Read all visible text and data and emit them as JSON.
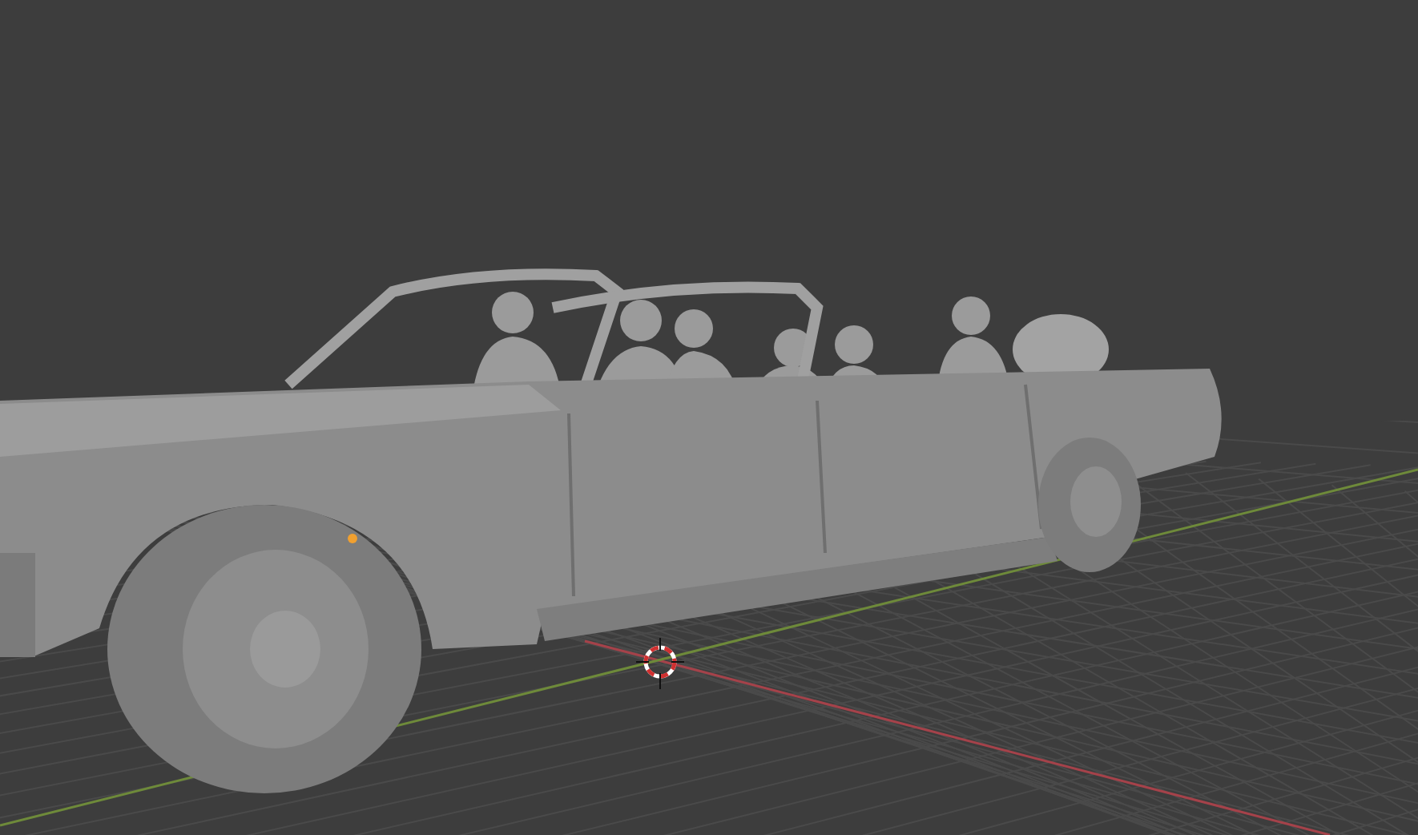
{
  "viewport": {
    "axes": [
      {
        "kind": "x",
        "color": "#a5424a"
      },
      {
        "kind": "y",
        "color": "#6e8a3a"
      }
    ]
  }
}
